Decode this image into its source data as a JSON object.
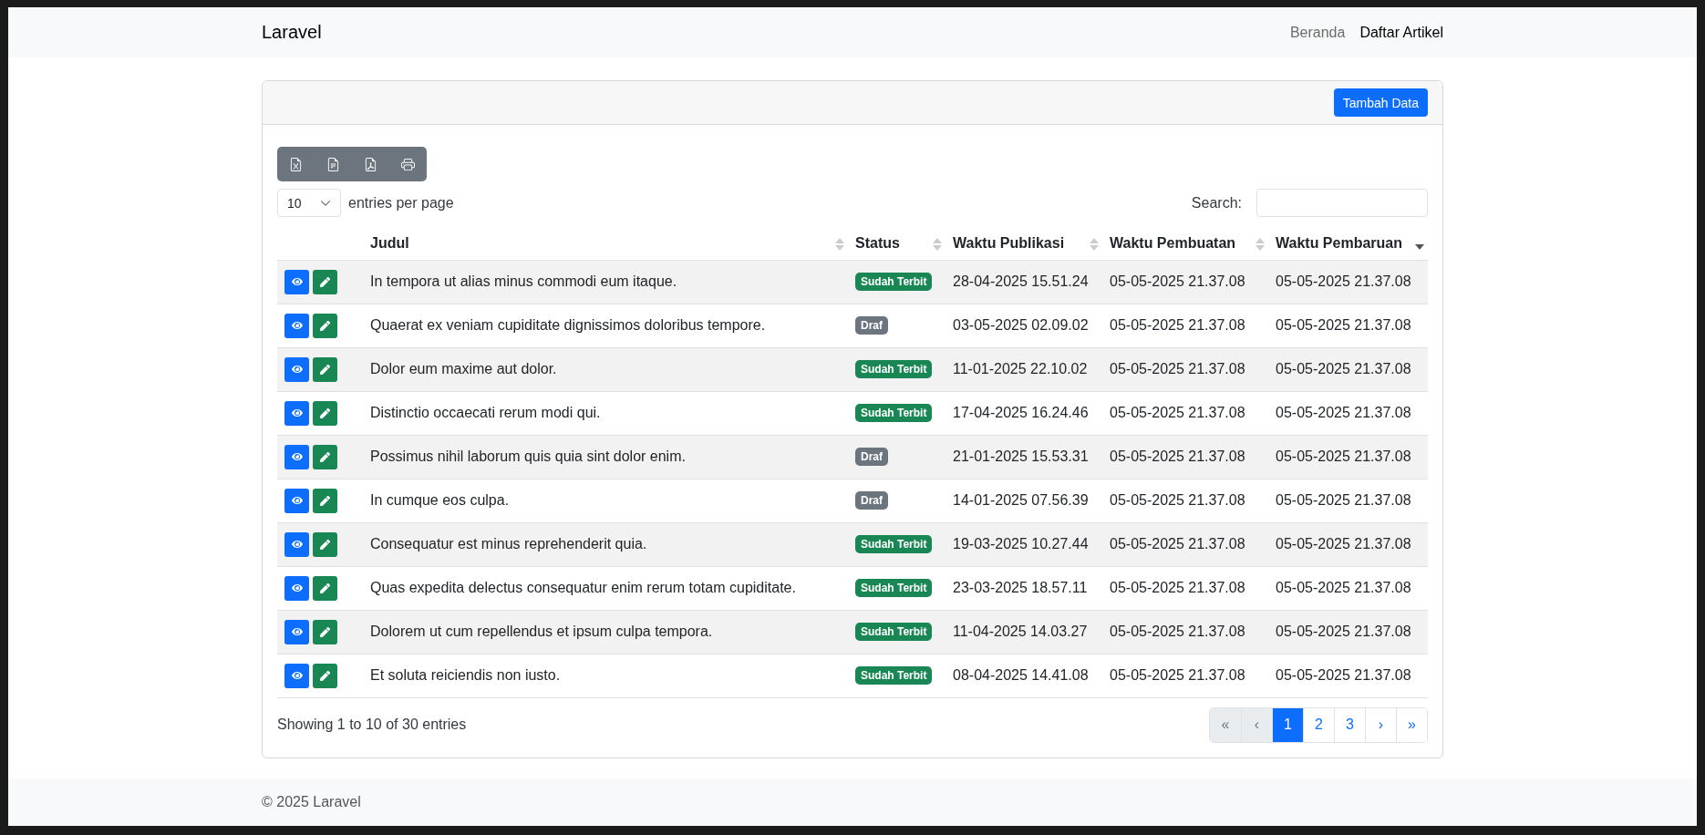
{
  "navbar": {
    "brand": "Laravel",
    "links": [
      {
        "label": "Beranda",
        "selected": false
      },
      {
        "label": "Daftar Artikel",
        "selected": true
      }
    ]
  },
  "card": {
    "add_button": "Tambah Data"
  },
  "table_controls": {
    "per_page": "10",
    "per_page_label": "entries per page",
    "search_label": "Search:"
  },
  "table": {
    "columns": [
      {
        "label": "Judul",
        "sorted": false
      },
      {
        "label": "Status",
        "sorted": false
      },
      {
        "label": "Waktu Publikasi",
        "sorted": false
      },
      {
        "label": "Waktu Pembuatan",
        "sorted": false
      },
      {
        "label": "Waktu Pembaruan",
        "sorted": true
      }
    ],
    "rows": [
      {
        "title": "In tempora ut alias minus commodi eum itaque.",
        "status": {
          "label": "Sudah Terbit",
          "kind": "published"
        },
        "published_at": "28-04-2025 15.51.24",
        "created_at": "05-05-2025 21.37.08",
        "updated_at": "05-05-2025 21.37.08"
      },
      {
        "title": "Quaerat ex veniam cupiditate dignissimos doloribus tempore.",
        "status": {
          "label": "Draf",
          "kind": "draft"
        },
        "published_at": "03-05-2025 02.09.02",
        "created_at": "05-05-2025 21.37.08",
        "updated_at": "05-05-2025 21.37.08"
      },
      {
        "title": "Dolor eum maxime aut dolor.",
        "status": {
          "label": "Sudah Terbit",
          "kind": "published"
        },
        "published_at": "11-01-2025 22.10.02",
        "created_at": "05-05-2025 21.37.08",
        "updated_at": "05-05-2025 21.37.08"
      },
      {
        "title": "Distinctio occaecati rerum modi qui.",
        "status": {
          "label": "Sudah Terbit",
          "kind": "published"
        },
        "published_at": "17-04-2025 16.24.46",
        "created_at": "05-05-2025 21.37.08",
        "updated_at": "05-05-2025 21.37.08"
      },
      {
        "title": "Possimus nihil laborum quis quia sint dolor enim.",
        "status": {
          "label": "Draf",
          "kind": "draft"
        },
        "published_at": "21-01-2025 15.53.31",
        "created_at": "05-05-2025 21.37.08",
        "updated_at": "05-05-2025 21.37.08"
      },
      {
        "title": "In cumque eos culpa.",
        "status": {
          "label": "Draf",
          "kind": "draft"
        },
        "published_at": "14-01-2025 07.56.39",
        "created_at": "05-05-2025 21.37.08",
        "updated_at": "05-05-2025 21.37.08"
      },
      {
        "title": "Consequatur est minus reprehenderit quia.",
        "status": {
          "label": "Sudah Terbit",
          "kind": "published"
        },
        "published_at": "19-03-2025 10.27.44",
        "created_at": "05-05-2025 21.37.08",
        "updated_at": "05-05-2025 21.37.08"
      },
      {
        "title": "Quas expedita delectus consequatur enim rerum totam cupiditate.",
        "status": {
          "label": "Sudah Terbit",
          "kind": "published"
        },
        "published_at": "23-03-2025 18.57.11",
        "created_at": "05-05-2025 21.37.08",
        "updated_at": "05-05-2025 21.37.08"
      },
      {
        "title": "Dolorem ut cum repellendus et ipsum culpa tempora.",
        "status": {
          "label": "Sudah Terbit",
          "kind": "published"
        },
        "published_at": "11-04-2025 14.03.27",
        "created_at": "05-05-2025 21.37.08",
        "updated_at": "05-05-2025 21.37.08"
      },
      {
        "title": "Et soluta reiciendis non iusto.",
        "status": {
          "label": "Sudah Terbit",
          "kind": "published"
        },
        "published_at": "08-04-2025 14.41.08",
        "created_at": "05-05-2025 21.37.08",
        "updated_at": "05-05-2025 21.37.08"
      }
    ]
  },
  "info": "Showing 1 to 10 of 30 entries",
  "pagination": [
    {
      "label": "«",
      "selected": false,
      "disabled": true
    },
    {
      "label": "‹",
      "selected": false,
      "disabled": true
    },
    {
      "label": "1",
      "selected": true,
      "disabled": false
    },
    {
      "label": "2",
      "selected": false,
      "disabled": false
    },
    {
      "label": "3",
      "selected": false,
      "disabled": false
    },
    {
      "label": "›",
      "selected": false,
      "disabled": false
    },
    {
      "label": "»",
      "selected": false,
      "disabled": false
    }
  ],
  "footer": "© 2025 Laravel"
}
